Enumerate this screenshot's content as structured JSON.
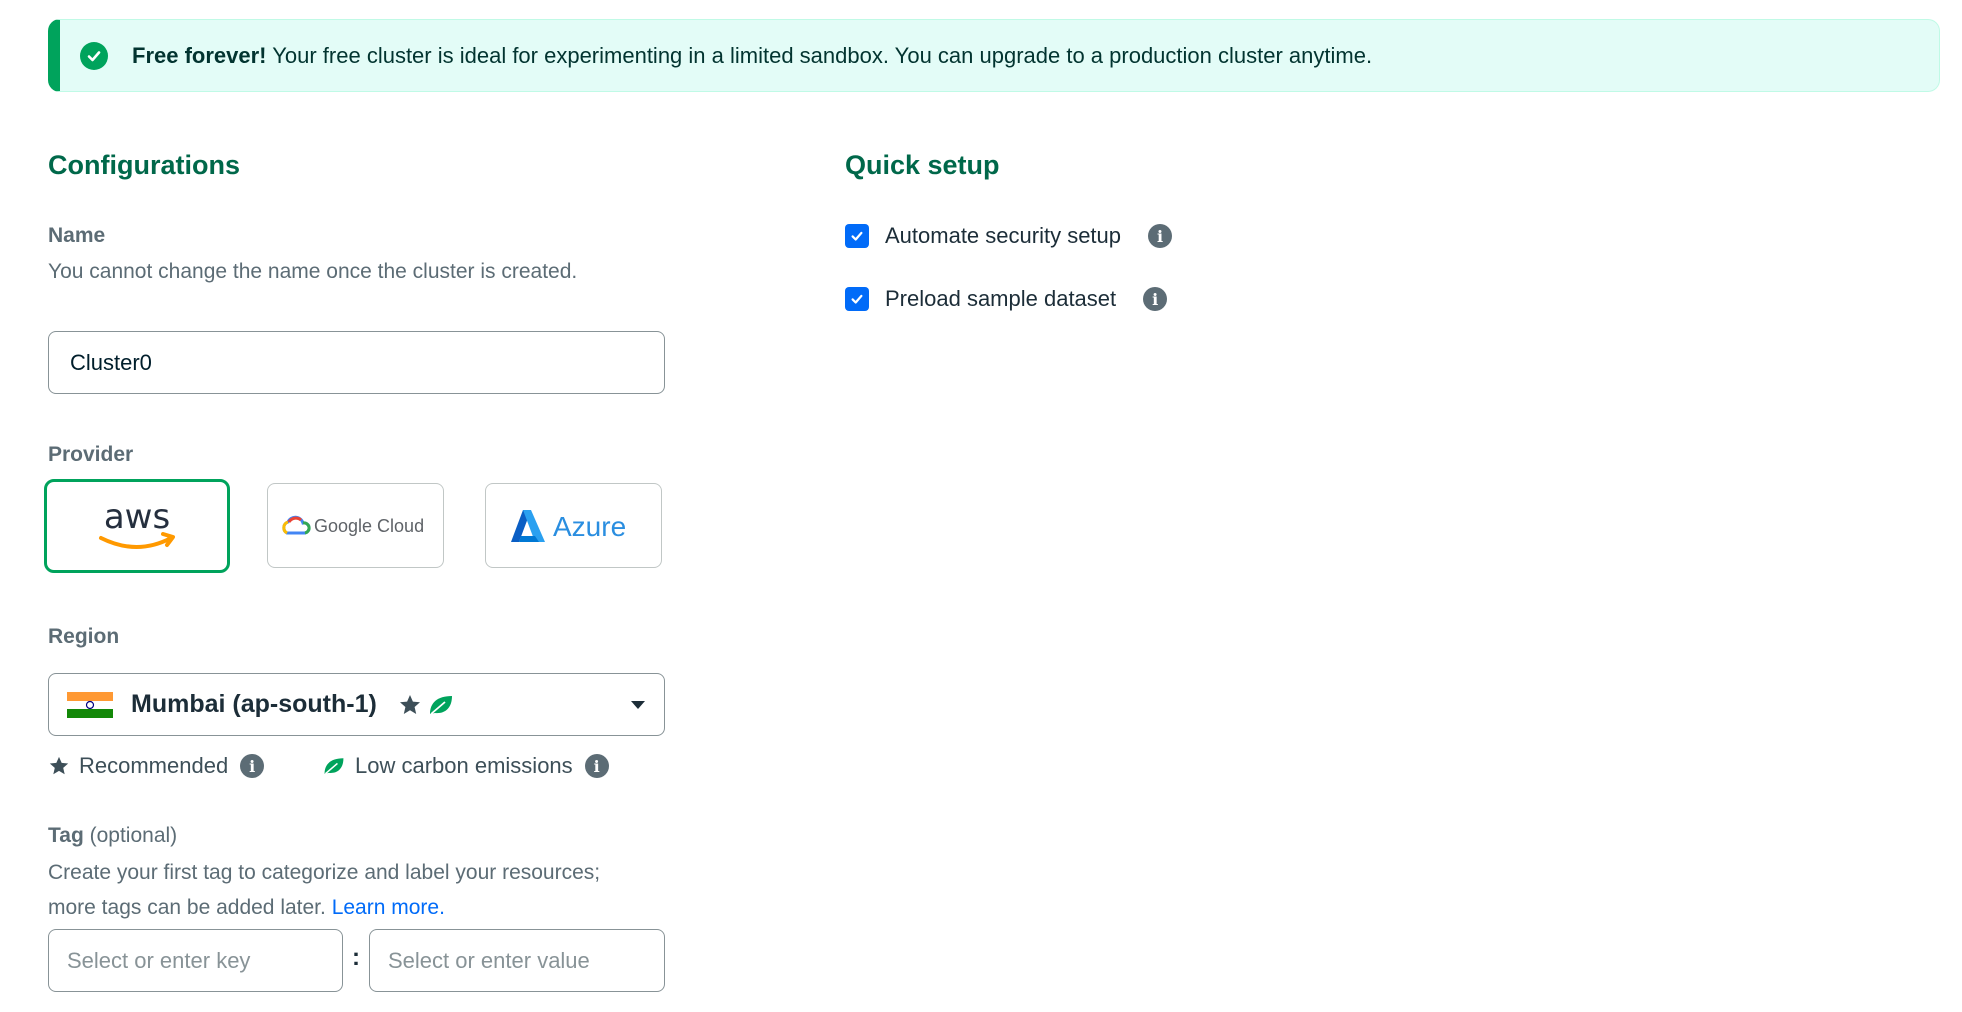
{
  "banner": {
    "icon": "check-circle-icon",
    "bold": "Free forever!",
    "text": " Your free cluster is ideal for experimenting in a limited sandbox. You can upgrade to a production cluster anytime."
  },
  "configurations": {
    "title": "Configurations",
    "name": {
      "label": "Name",
      "description": "You cannot change the name once the cluster is created.",
      "value": "Cluster0"
    },
    "provider": {
      "label": "Provider",
      "options": [
        {
          "name": "aws",
          "selected": true
        },
        {
          "name": "Google Cloud",
          "selected": false
        },
        {
          "name": "Azure",
          "selected": false
        }
      ]
    },
    "region": {
      "label": "Region",
      "value": "Mumbai (ap-south-1)",
      "flag": "india-flag-icon",
      "legend_recommended": "Recommended",
      "legend_low_carbon": "Low carbon emissions"
    },
    "tag": {
      "label": "Tag",
      "optional": "(optional)",
      "description": "Create your first tag to categorize and label your resources; more tags can be added later.",
      "learn_more": "Learn more.",
      "key_placeholder": "Select or enter key",
      "separator": ":",
      "value_placeholder": "Select or enter value"
    }
  },
  "quick_setup": {
    "title": "Quick setup",
    "options": [
      {
        "label": "Automate security setup",
        "checked": true
      },
      {
        "label": "Preload sample dataset",
        "checked": true
      }
    ]
  },
  "colors": {
    "brand_green": "#00684a",
    "accent_green": "#00a35c",
    "link_blue": "#016bf8"
  }
}
